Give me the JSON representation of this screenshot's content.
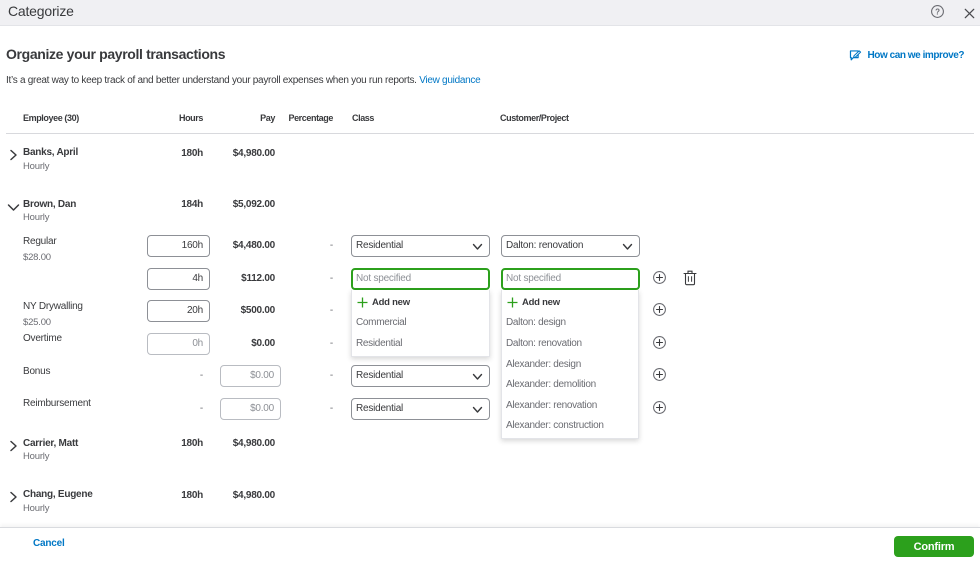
{
  "titlebar": {
    "title": "Categorize"
  },
  "header": {
    "heading": "Organize your payroll transactions",
    "improve_link": "How can we improve?",
    "subtitle": "It’s a great way to keep track of and better understand your payroll expenses when you run reports.",
    "guidance_link": "View guidance"
  },
  "table": {
    "columns": {
      "employee": "Employee (30)",
      "hours": "Hours",
      "pay": "Pay",
      "percentage": "Percentage",
      "class": "Class",
      "customer": "Customer/Project"
    }
  },
  "employees": {
    "banks": {
      "name": "Banks, April",
      "type": "Hourly",
      "hours": "180h",
      "pay": "$4,980.00"
    },
    "brown": {
      "name": "Brown, Dan",
      "type": "Hourly",
      "hours": "184h",
      "pay": "$5,092.00"
    },
    "carrier": {
      "name": "Carrier, Matt",
      "type": "Hourly",
      "hours": "180h",
      "pay": "$4,980.00"
    },
    "chang": {
      "name": "Chang, Eugene",
      "type": "Hourly",
      "hours": "180h",
      "pay": "$4,980.00"
    }
  },
  "pay_items": {
    "regular": {
      "label": "Regular",
      "rate": "$28.00",
      "hours": "160h",
      "pay": "$4,480.00",
      "percentage": "-",
      "class_value": "Residential",
      "customer_value": "Dalton: renovation"
    },
    "split": {
      "hours": "4h",
      "pay": "$112.00",
      "percentage": "-",
      "class_placeholder": "Not specified",
      "customer_placeholder": "Not specified"
    },
    "ny_drywalling": {
      "label": "NY Drywalling",
      "rate": "$25.00",
      "hours": "20h",
      "pay": "$500.00",
      "percentage": "-"
    },
    "overtime": {
      "label": "Overtime",
      "hours": "0h",
      "pay": "$0.00",
      "percentage": "-"
    },
    "bonus": {
      "label": "Bonus",
      "hours_dash": "-",
      "pay": "$0.00",
      "percentage": "-",
      "class_value": "Residential"
    },
    "reimbursement": {
      "label": "Reimbursement",
      "hours_dash": "-",
      "pay": "$0.00",
      "percentage": "-",
      "class_value": "Residential"
    }
  },
  "class_menu": {
    "add_new": "Add new",
    "items": [
      "Commercial",
      "Residential"
    ]
  },
  "customer_menu": {
    "add_new": "Add new",
    "items": [
      "Dalton: design",
      "Dalton: renovation",
      "Alexander: design",
      "Alexander: demolition",
      "Alexander: renovation",
      "Alexander: construction"
    ]
  },
  "footer": {
    "cancel": "Cancel",
    "confirm": "Confirm"
  },
  "colors": {
    "accent_green": "#2ca01c",
    "link_blue": "#0077c5",
    "text": "#393a3d",
    "muted": "#6b6c72"
  }
}
